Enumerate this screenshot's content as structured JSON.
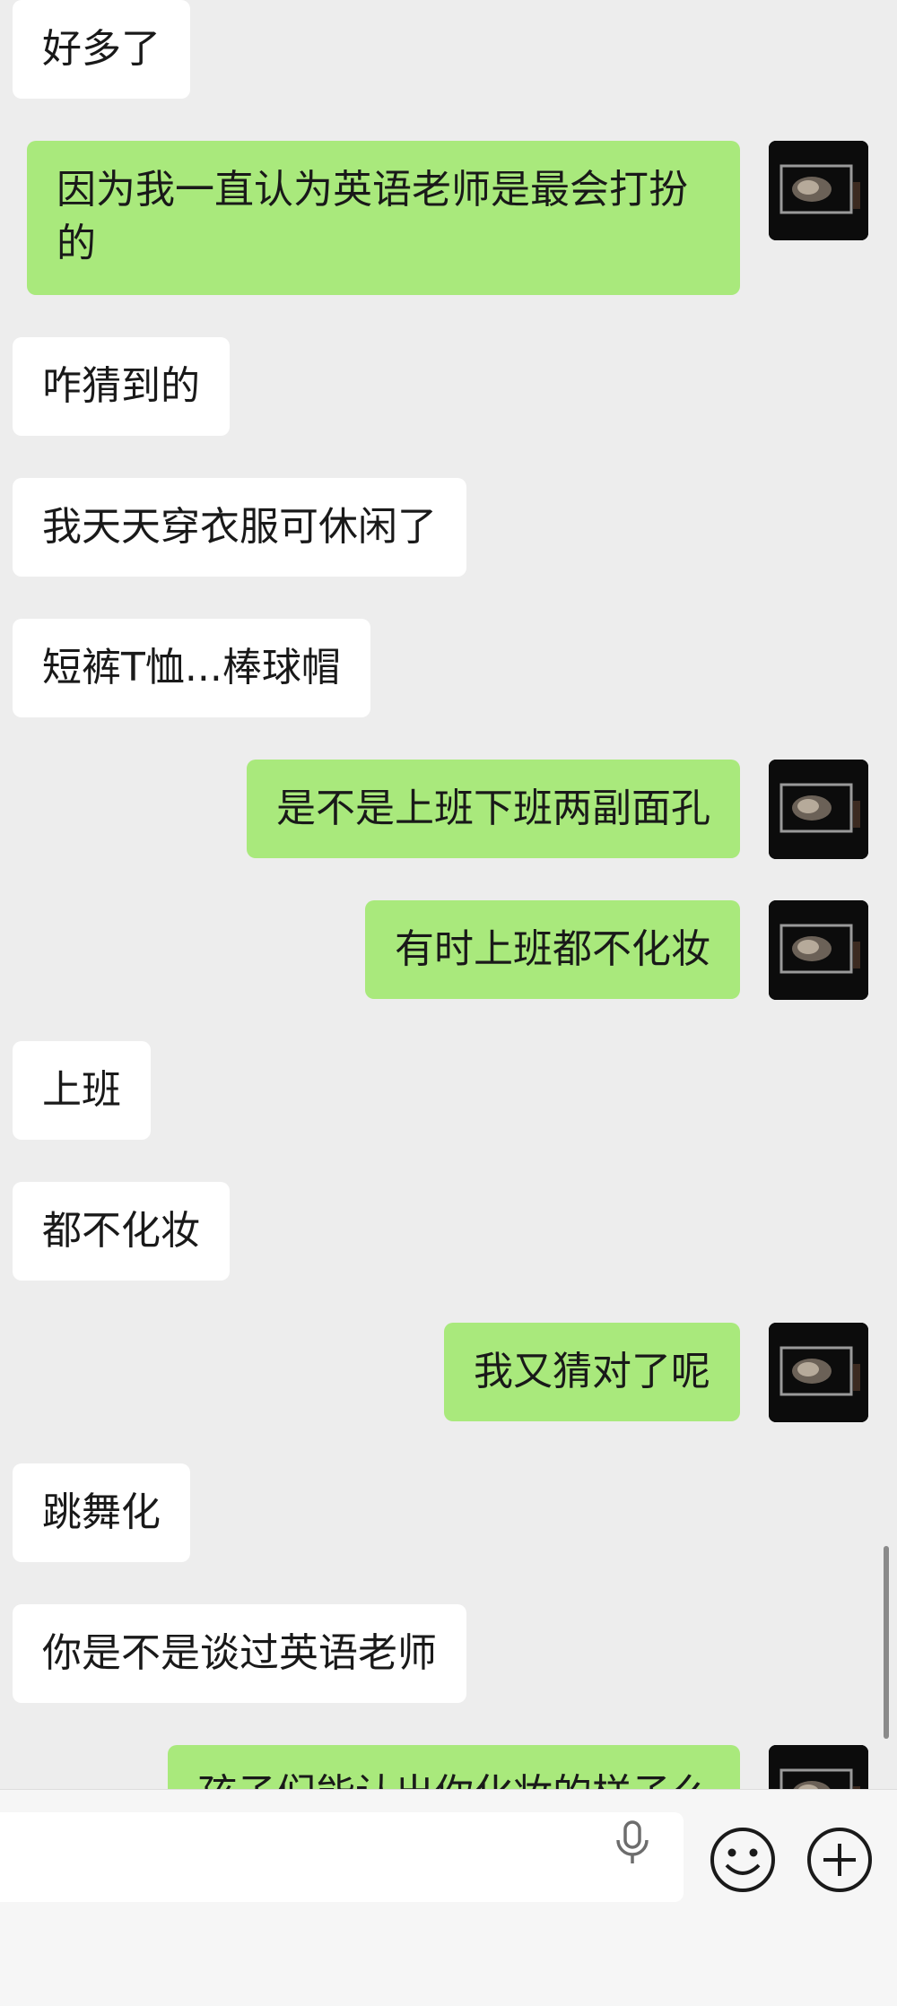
{
  "messages": [
    {
      "side": "left",
      "text": "好多了"
    },
    {
      "side": "right",
      "text": "因为我一直认为英语老师是最会打扮的"
    },
    {
      "side": "left",
      "text": "咋猜到的"
    },
    {
      "side": "left",
      "text": "我天天穿衣服可休闲了"
    },
    {
      "side": "left",
      "text": "短裤T恤...棒球帽"
    },
    {
      "side": "right",
      "text": "是不是上班下班两副面孔"
    },
    {
      "side": "right",
      "text": "有时上班都不化妆"
    },
    {
      "side": "left",
      "text": "上班"
    },
    {
      "side": "left",
      "text": "都不化妆"
    },
    {
      "side": "right",
      "text": "我又猜对了呢"
    },
    {
      "side": "left",
      "text": "跳舞化"
    },
    {
      "side": "left",
      "text": "你是不是谈过英语老师"
    },
    {
      "side": "right",
      "text": "孩子们能认出你化妆的样子么"
    }
  ],
  "input": {
    "value": ""
  },
  "icons": {
    "voice": "microphone-icon",
    "emoji": "smiley-icon",
    "more": "plus-circle-icon"
  },
  "colors": {
    "background": "#ededed",
    "incoming_bubble": "#ffffff",
    "outgoing_bubble": "#a9e97c",
    "text": "#191919"
  }
}
